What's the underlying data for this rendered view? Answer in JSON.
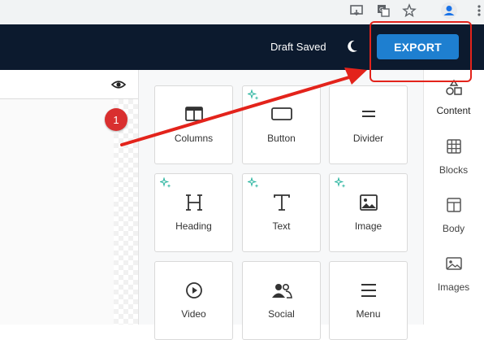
{
  "header": {
    "draft_status": "Draft Saved",
    "export_label": "EXPORT"
  },
  "annotation": {
    "step_number": "1"
  },
  "blocks": [
    {
      "label": "Columns",
      "icon": "columns-icon",
      "ai": false
    },
    {
      "label": "Button",
      "icon": "button-icon",
      "ai": true
    },
    {
      "label": "Divider",
      "icon": "divider-icon",
      "ai": false
    },
    {
      "label": "Heading",
      "icon": "heading-icon",
      "ai": true
    },
    {
      "label": "Text",
      "icon": "text-icon",
      "ai": true
    },
    {
      "label": "Image",
      "icon": "image-icon",
      "ai": true
    },
    {
      "label": "Video",
      "icon": "video-icon",
      "ai": false
    },
    {
      "label": "Social",
      "icon": "social-icon",
      "ai": false
    },
    {
      "label": "Menu",
      "icon": "menu-icon",
      "ai": false
    }
  ],
  "sidebar": {
    "items": [
      {
        "label": "Content",
        "icon": "shapes-icon",
        "active": true
      },
      {
        "label": "Blocks",
        "icon": "blocks-grid-icon",
        "active": false
      },
      {
        "label": "Body",
        "icon": "layout-icon",
        "active": false
      },
      {
        "label": "Images",
        "icon": "images-icon",
        "active": false
      }
    ]
  },
  "colors": {
    "header_bg": "#0c1a2e",
    "export_bg": "#1e7fd0",
    "annotation_red": "#e3231b",
    "sparkle_teal": "#2bb5a0"
  }
}
